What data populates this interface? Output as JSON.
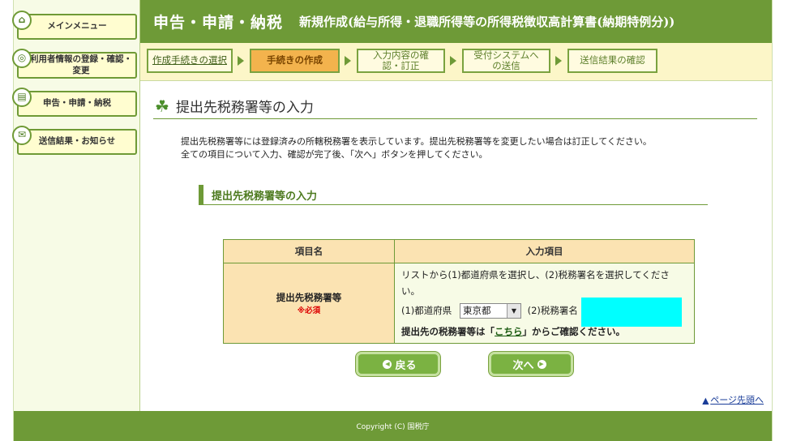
{
  "sidebar": {
    "items": [
      {
        "label": "メインメニュー",
        "icon": "home-icon"
      },
      {
        "label": "利用者情報の登録・確認・変更",
        "icon": "user-settings-icon"
      },
      {
        "label": "申告・申請・納税",
        "icon": "document-icon"
      },
      {
        "label": "送信結果・お知らせ",
        "icon": "mail-icon"
      }
    ]
  },
  "header": {
    "title": "申告・申請・納税",
    "subtitle": "新規作成(給与所得・退職所得等の所得税徴収高計算書(納期特例分))"
  },
  "steps": [
    {
      "label": "作成手続きの選択"
    },
    {
      "label": "手続きの作成"
    },
    {
      "label": "入力内容の確認・訂正"
    },
    {
      "label": "受付システムへの送信"
    },
    {
      "label": "送信結果の確認"
    }
  ],
  "main": {
    "title": "提出先税務署等の入力",
    "desc_line1": "提出先税務署等には登録済みの所轄税務署を表示しています。提出先税務署等を変更したい場合は訂正してください。",
    "desc_line2": "全ての項目について入力、確認が完了後、「次へ」ボタンを押してください。",
    "section_title": "提出先税務署等の入力",
    "table": {
      "col1": "項目名",
      "col2": "入力項目",
      "row_label": "提出先税務署等",
      "required": "※必須",
      "instruction": "リストから(1)都道府県を選択し、(2)税務署名を選択してください。",
      "pref_label": "(1)都道府県",
      "pref_value": "東京都",
      "office_label": "(2)税務署名",
      "confirm_prefix": "提出先の税務署等は「",
      "confirm_link": "こちら",
      "confirm_suffix": "」からご確認ください。"
    }
  },
  "buttons": {
    "back": "戻る",
    "next": "次へ"
  },
  "page_top": "ページ先頭へ",
  "footer": "Copyright (C) 国税庁",
  "colors": {
    "accent_green": "#6e9a37",
    "active_step": "#f3b34d",
    "highlight": "#00ffff"
  }
}
